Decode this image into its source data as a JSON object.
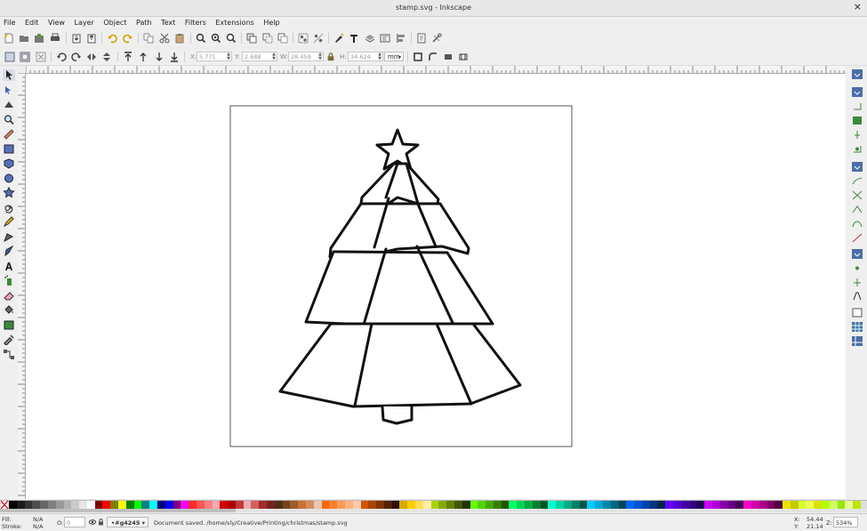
{
  "window": {
    "title": "stamp.svg - Inkscape",
    "close_glyph": "×"
  },
  "menu": [
    "File",
    "Edit",
    "View",
    "Layer",
    "Object",
    "Path",
    "Text",
    "Filters",
    "Extensions",
    "Help"
  ],
  "controls": {
    "x_label": "X:",
    "x_value": "5.771",
    "y_label": "Y:",
    "y_value": "2.688",
    "w_label": "W:",
    "w_value": "28.459",
    "h_label": "H:",
    "h_value": "34.624",
    "unit": "mm"
  },
  "status": {
    "fill_label": "Fill:",
    "fill_value": "N/A",
    "stroke_label": "Stroke:",
    "stroke_value": "N/A",
    "opacity_label": "O:",
    "opacity_value": "0",
    "layer": "•#g4245",
    "message": "Document saved. /home/sly/Creative/Printing/christmas/stamp.svg",
    "x_label": "X:",
    "x_value": "54.44",
    "y_label": "Y:",
    "y_value": "21.14",
    "zoom_label": "Z:",
    "zoom_value": "534%"
  },
  "palette_colors": [
    "#000000",
    "#1a1a1a",
    "#333333",
    "#4d4d4d",
    "#666666",
    "#808080",
    "#999999",
    "#b3b3b3",
    "#cccccc",
    "#e6e6e6",
    "#ffffff",
    "#800000",
    "#ff0000",
    "#808000",
    "#ffff00",
    "#008000",
    "#00ff00",
    "#008080",
    "#00ffff",
    "#000080",
    "#0000ff",
    "#800080",
    "#ff00ff",
    "#ff2a2a",
    "#ff5555",
    "#ff8080",
    "#ffaaaa",
    "#d40000",
    "#aa0000",
    "#c83737",
    "#e9afaf",
    "#d35f5f",
    "#a02c2c",
    "#782121",
    "#502d16",
    "#784421",
    "#a05a2c",
    "#c87137",
    "#d38d5f",
    "#e9c6af",
    "#ff6600",
    "#ff7f2a",
    "#ff9955",
    "#ffb380",
    "#ffccaa",
    "#d45500",
    "#aa4400",
    "#803300",
    "#552200",
    "#2b1100",
    "#d4aa00",
    "#ffcc00",
    "#ffdd55",
    "#ffeeaa",
    "#aad400",
    "#88aa00",
    "#668000",
    "#445500",
    "#223300",
    "#66ff00",
    "#55d400",
    "#44aa00",
    "#338000",
    "#225500",
    "#00ff66",
    "#00d455",
    "#00aa44",
    "#008033",
    "#005522",
    "#00ffcc",
    "#00d4aa",
    "#00aa88",
    "#008066",
    "#005544",
    "#00ccff",
    "#00aad4",
    "#0088aa",
    "#006680",
    "#004455",
    "#0066ff",
    "#0055d4",
    "#0044aa",
    "#003380",
    "#002255",
    "#6600ff",
    "#5500d4",
    "#4400aa",
    "#330080",
    "#220055",
    "#cc00ff",
    "#aa00d4",
    "#8800aa",
    "#660080",
    "#440055",
    "#ff00cc",
    "#d400aa",
    "#aa0088",
    "#800066",
    "#550044",
    "#e6e600",
    "#c8c800",
    "#d4ff2a",
    "#eeff55",
    "#d4e600",
    "#b3ff00",
    "#ccff66",
    "#99e600",
    "#e6ff99",
    "#bfe600"
  ]
}
